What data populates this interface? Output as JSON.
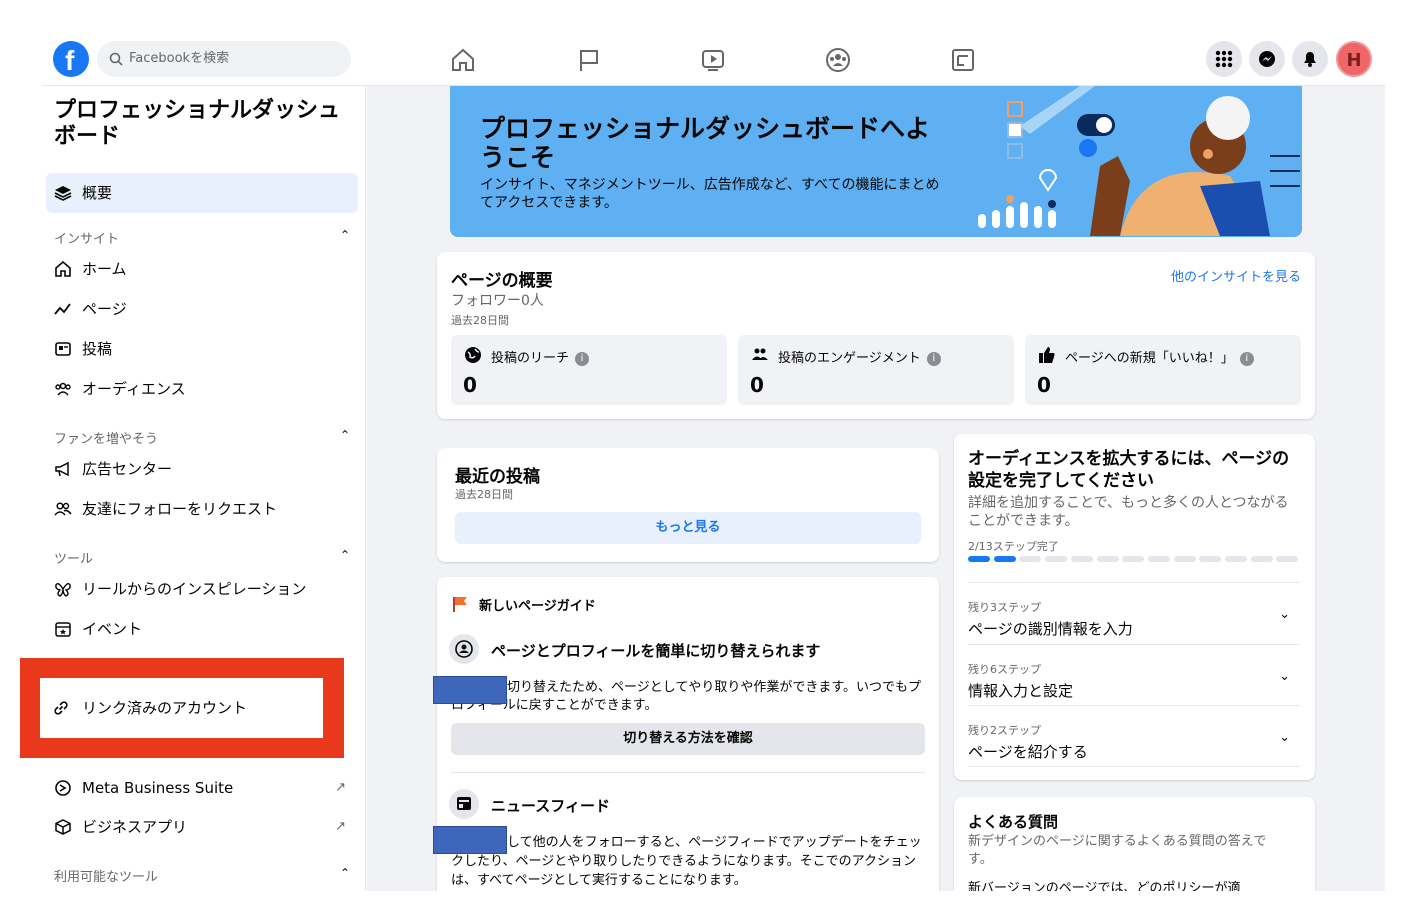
{
  "topbar": {
    "search_placeholder": "Facebookを検索",
    "avatar_letter": "H"
  },
  "sidebar": {
    "title": "プロフェッショナルダッシュボード",
    "overview": "概要",
    "sections": {
      "insights": "インサイト",
      "grow": "ファンを増やそう",
      "tools": "ツール",
      "available": "利用可能なツール"
    },
    "items": {
      "home": "ホーム",
      "page": "ページ",
      "posts": "投稿",
      "audience": "オーディエンス",
      "ad_center": "広告センター",
      "invite_friends": "友達にフォローをリクエスト",
      "reels": "リールからのインスピレーション",
      "events": "イベント",
      "linked_accounts": "リンク済みのアカウント",
      "meta_business": "Meta Business Suite",
      "business_apps": "ビジネスアプリ"
    }
  },
  "banner": {
    "title": "プロフェッショナルダッシュボードへようこそ",
    "text": "インサイト、マネジメントツール、広告作成など、すべての機能にまとめてアクセスできます。"
  },
  "overview": {
    "title": "ページの概要",
    "followers": "フォロワー0人",
    "period": "過去28日間",
    "more_insights": "他のインサイトを見る",
    "metrics": [
      {
        "label": "投稿のリーチ",
        "value": "0"
      },
      {
        "label": "投稿のエンゲージメント",
        "value": "0"
      },
      {
        "label": "ページへの新規「いいね！」",
        "value": "0"
      }
    ]
  },
  "recent": {
    "title": "最近の投稿",
    "period": "過去28日間",
    "more": "もっと見る"
  },
  "guide": {
    "title": "新しいページガイド",
    "switch_title": "ページとプロフィールを簡単に切り替えられます",
    "switch_text": "切り替えたため、ページとしてやり取りや作業ができます。いつでもプロフィールに戻すことができます。",
    "switch_btn": "切り替える方法を確認",
    "feed_title": "ニュースフィード",
    "feed_text": "して他の人をフォローすると、ページフィードでアップデートをチェックしたり、ページとやり取りしたりできるようになります。そこでのアクションは、すべてページとして実行することになります。"
  },
  "setup": {
    "title": "オーディエンスを拡大するには、ページの設定を完了してください",
    "text": "詳細を追加することで、もっと多くの人とつながることができます。",
    "progress_label": "2/13ステップ完了",
    "progress_done": 2,
    "progress_total": 13,
    "steps": [
      {
        "count": "残り3ステップ",
        "label": "ページの識別情報を入力"
      },
      {
        "count": "残り6ステップ",
        "label": "情報入力と設定"
      },
      {
        "count": "残り2ステップ",
        "label": "ページを紹介する"
      }
    ]
  },
  "faq": {
    "title": "よくある質問",
    "text": "新デザインのページに関するよくある質問の答えです。",
    "cut": "新バージョンのページでは、どのポリシーが適"
  },
  "colors": {
    "brand": "#1877f2",
    "banner": "#5fb0f2",
    "highlight": "#e8391c"
  }
}
